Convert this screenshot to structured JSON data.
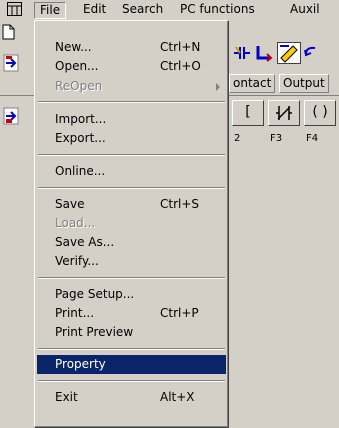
{
  "menubar": {
    "items": [
      "File",
      "Edit",
      "Search",
      "PC functions",
      "Auxil"
    ]
  },
  "toolbar": {
    "tabs": [
      "ontact",
      "Output"
    ],
    "ladder_symbols": [
      "[",
      "⥉",
      "( )"
    ],
    "function_keys": [
      "2",
      "F3",
      "F4"
    ]
  },
  "file_menu": {
    "items": [
      {
        "label": "New...",
        "shortcut": "Ctrl+N",
        "state": "normal"
      },
      {
        "label": "Open...",
        "shortcut": "Ctrl+O",
        "state": "normal"
      },
      {
        "label": "ReOpen",
        "shortcut": "",
        "state": "disabled",
        "submenu": true
      },
      {
        "label": "Import...",
        "shortcut": "",
        "state": "normal"
      },
      {
        "label": "Export...",
        "shortcut": "",
        "state": "normal"
      },
      {
        "label": "Online...",
        "shortcut": "",
        "state": "normal"
      },
      {
        "label": "Save",
        "shortcut": "Ctrl+S",
        "state": "normal"
      },
      {
        "label": "Load...",
        "shortcut": "",
        "state": "disabled"
      },
      {
        "label": "Save As...",
        "shortcut": "",
        "state": "normal"
      },
      {
        "label": "Verify...",
        "shortcut": "",
        "state": "normal"
      },
      {
        "label": "Page Setup...",
        "shortcut": "",
        "state": "normal"
      },
      {
        "label": "Print...",
        "shortcut": "Ctrl+P",
        "state": "normal"
      },
      {
        "label": "Print Preview",
        "shortcut": "",
        "state": "normal"
      },
      {
        "label": "Property",
        "shortcut": "",
        "state": "selected"
      },
      {
        "label": "Exit",
        "shortcut": "Alt+X",
        "state": "normal"
      }
    ]
  },
  "colors": {
    "face": "#d4d0c8",
    "highlight": "#0a246a",
    "disabled": "#808080"
  }
}
